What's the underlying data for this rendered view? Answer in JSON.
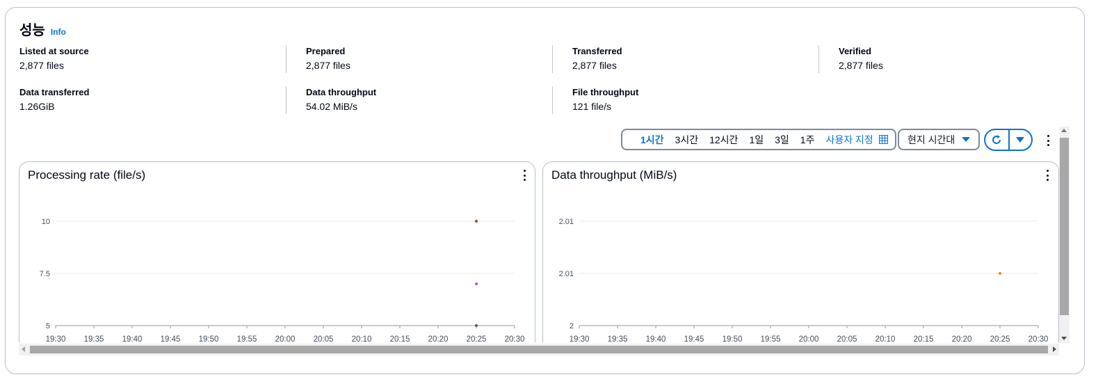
{
  "header": {
    "title": "성능",
    "info": "Info"
  },
  "metrics": {
    "row1": [
      {
        "label": "Listed at source",
        "value": "2,877 files"
      },
      {
        "label": "Prepared",
        "value": "2,877 files"
      },
      {
        "label": "Transferred",
        "value": "2,877 files"
      },
      {
        "label": "Verified",
        "value": "2,877 files"
      }
    ],
    "row2": [
      {
        "label": "Data transferred",
        "value": "1.26GiB"
      },
      {
        "label": "Data throughput",
        "value": "54.02 MiB/s"
      },
      {
        "label": "File throughput",
        "value": "121 file/s"
      }
    ]
  },
  "toolbar": {
    "ranges": [
      "1시간",
      "3시간",
      "12시간",
      "1일",
      "3일",
      "1주"
    ],
    "selected_range": "1시간",
    "custom_label": "사용자 지정",
    "timezone": "현지 시간대",
    "accent": "#0972d3"
  },
  "chart_data": [
    {
      "type": "scatter",
      "title": "Processing rate (file/s)",
      "x_ticks": [
        "19:30",
        "19:35",
        "19:40",
        "19:45",
        "19:50",
        "19:55",
        "20:00",
        "20:05",
        "20:10",
        "20:15",
        "20:20",
        "20:25",
        "20:30"
      ],
      "y_ticks": [
        "5",
        "7.5",
        "10"
      ],
      "ylim": [
        5,
        10
      ],
      "series": [
        {
          "color": "#8c4a2f",
          "points": [
            {
              "x": "20:25",
              "y": 10
            }
          ]
        },
        {
          "color": "#a05ec4",
          "points": [
            {
              "x": "20:25",
              "y": 7
            }
          ]
        },
        {
          "color": "#5c5c5c",
          "points": [
            {
              "x": "20:25",
              "y": 5
            }
          ]
        }
      ]
    },
    {
      "type": "scatter",
      "title": "Data throughput (MiB/s)",
      "x_ticks": [
        "19:30",
        "19:35",
        "19:40",
        "19:45",
        "19:50",
        "19:55",
        "20:00",
        "20:05",
        "20:10",
        "20:15",
        "20:20",
        "20:25",
        "20:30"
      ],
      "y_ticks": [
        "2",
        "2.01",
        "2.01"
      ],
      "series": [
        {
          "color": "#ff7f0e",
          "points": [
            {
              "x": "20:25",
              "y": 2.01
            }
          ]
        }
      ]
    }
  ]
}
